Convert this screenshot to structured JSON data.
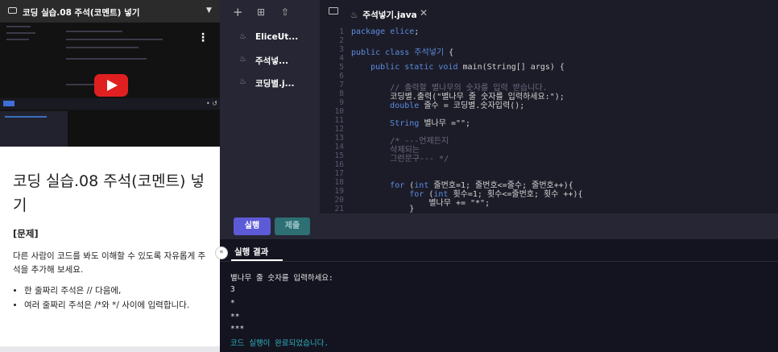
{
  "video": {
    "title": "코딩 실습.08 주석(코멘트) 넣기",
    "menu_glyph": "⋮"
  },
  "lesson": {
    "title": "코딩 실습.08 주석(코멘트) 넣기",
    "problem_label": "[문제]",
    "problem_text": "다른 사람이 코드를 봐도 이해할 수 있도록 자유롭게 주석을 추가해 보세요.",
    "bullets": [
      "한 줄짜리 주석은 // 다음에,",
      "여러 줄짜리 주석은 /*와 */ 사이에 입력합니다."
    ]
  },
  "explorer": {
    "files": [
      {
        "name": "EliceUt..."
      },
      {
        "name": "주석넣..."
      },
      {
        "name": "코딩별.j..."
      }
    ]
  },
  "editor": {
    "tab_name": "주석넣기.java",
    "close_glyph": "✕",
    "line_numbers": [
      "1",
      "2",
      "3",
      "4",
      "5",
      "6",
      "7",
      "8",
      "9",
      "10",
      "11",
      "12",
      "13",
      "14",
      "15",
      "16",
      "17",
      "18",
      "19",
      "20",
      "21"
    ]
  },
  "runbar": {
    "run_label": "실행",
    "submit_label": "제출"
  },
  "output": {
    "tab_label": "실행 결과",
    "lines": [
      "별나무 줄 숫자를 입력하세요:",
      "3",
      "*",
      "**",
      "***"
    ],
    "done_message": "코드 실행이 완료되었습니다."
  },
  "colors": {
    "accent_run": "#5d5ad8",
    "submit": "#2e6f74",
    "keyword": "#5b8de0",
    "success": "#2fb3c0"
  },
  "icons": [
    "video-icon",
    "chevron-down-icon",
    "kebab-icon",
    "play-icon",
    "plus-icon",
    "new-folder-icon",
    "upload-icon",
    "folder-icon",
    "java-file-icon",
    "close-icon",
    "collapse-arrow-icon"
  ]
}
